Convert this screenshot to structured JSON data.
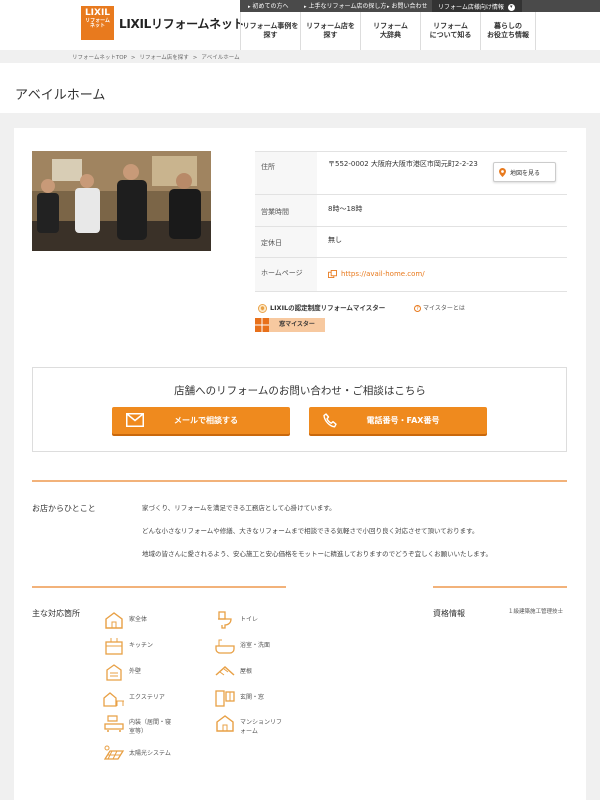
{
  "header": {
    "logo_top": "LIXIL",
    "logo_sub": "リフォーム\nネット",
    "site_name": "LIXILリフォームネット",
    "top_links": [
      "初めての方へ",
      "上手なリフォーム店の探し方",
      "お問い合わせ"
    ],
    "top_cta": "リフォーム店様向け情報",
    "nav": [
      "リフォーム事例を\n探す",
      "リフォーム店を\n探す",
      "リフォーム\n大辞典",
      "リフォーム\nについて知る",
      "暮らしの\nお役立ち情報"
    ]
  },
  "breadcrumb": [
    "リフォームネットTOP",
    "リフォーム店を探す",
    "アベイルホーム"
  ],
  "page_title": "アベイルホーム",
  "info": {
    "address_label": "住所",
    "address_value": "〒552-0002 大阪府大阪市港区市岡元町2-2-23",
    "map_button": "地図を見る",
    "hours_label": "営業時間",
    "hours_value": "8時～18時",
    "holiday_label": "定休日",
    "holiday_value": "無し",
    "homepage_label": "ホームページ",
    "homepage_value": "https://avail-home.com/"
  },
  "meister": {
    "title": "LIXILの認定制度リフォームマイスター",
    "help": "マイスターとは",
    "badge": "窓マイスター"
  },
  "contact": {
    "title": "店舗へのリフォームのお問い合わせ・ご相談はこちら",
    "mail_button": "メールで相談する",
    "phone_button": "電話番号・FAX番号"
  },
  "message_section": {
    "label": "お店からひとこと",
    "lines": [
      "家づくり、リフォームを満足できる工務店として心掛けています。",
      "どんな小さなリフォームや修繕、大きなリフォームまで相談できる気軽さで小回り良く対応させて頂いております。",
      "地域の皆さんに愛されるよう、安心施工と安心価格をモットーに精進しておりますのでどうぞ宜しくお願いいたします。"
    ]
  },
  "categories_section": {
    "label": "主な対応箇所",
    "items": [
      {
        "label": "家全体",
        "icon": "house-icon"
      },
      {
        "label": "トイレ",
        "icon": "toilet-icon"
      },
      {
        "label": "キッチン",
        "icon": "kitchen-icon"
      },
      {
        "label": "浴室・洗面",
        "icon": "bath-icon"
      },
      {
        "label": "外壁",
        "icon": "exterior-wall-icon"
      },
      {
        "label": "屋根",
        "icon": "roof-icon"
      },
      {
        "label": "エクステリア",
        "icon": "exterior-icon"
      },
      {
        "label": "玄関・窓",
        "icon": "door-window-icon"
      },
      {
        "label": "内装（居間・寝\n室等）",
        "icon": "interior-icon"
      },
      {
        "label": "マンションリフ\nォーム",
        "icon": "apartment-icon"
      },
      {
        "label": "太陽光システム",
        "icon": "solar-icon"
      }
    ]
  },
  "qualification": {
    "label": "資格情報",
    "value": "１級建築施工管理技士"
  },
  "colors": {
    "accent": "#ef8a1e",
    "accent_light": "#f2b27a",
    "topbar": "#4a4a4a",
    "background": "#f0f0f0"
  }
}
